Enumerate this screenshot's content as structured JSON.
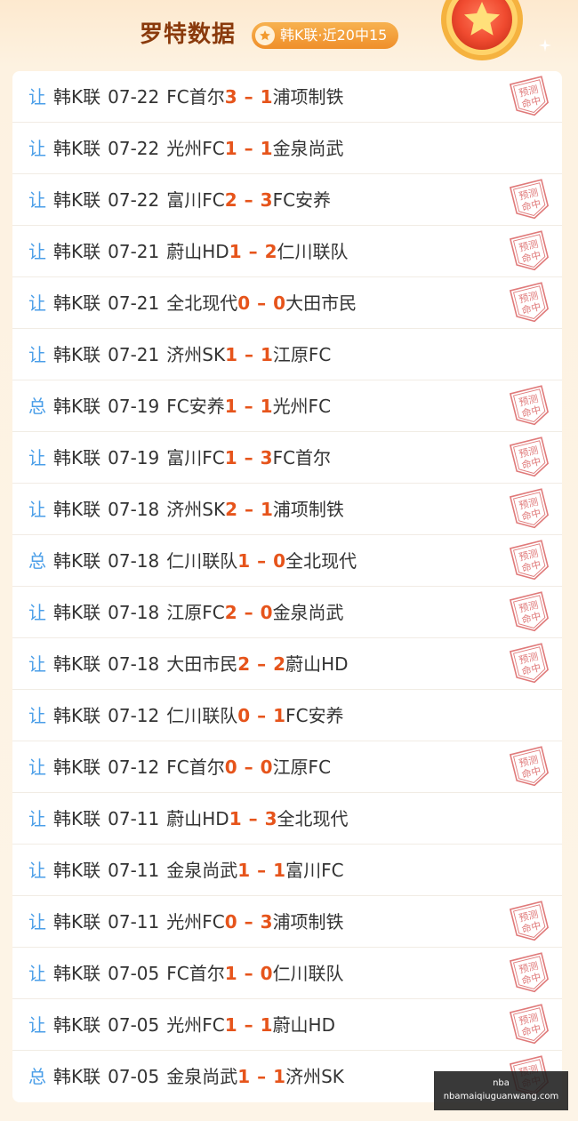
{
  "header": {
    "title": "罗特数据",
    "badge_text": "韩K联·近20中15"
  },
  "hit_stamp_text": "预测命中",
  "rows": [
    {
      "type": "让",
      "league": "韩K联",
      "date": "07-22",
      "home": "FC首尔",
      "home_score": "3",
      "away_score": "1",
      "away": "浦项制铁",
      "hit": true
    },
    {
      "type": "让",
      "league": "韩K联",
      "date": "07-22",
      "home": "光州FC",
      "home_score": "1",
      "away_score": "1",
      "away": "金泉尚武",
      "hit": false
    },
    {
      "type": "让",
      "league": "韩K联",
      "date": "07-22",
      "home": "富川FC",
      "home_score": "2",
      "away_score": "3",
      "away": "FC安养",
      "hit": true
    },
    {
      "type": "让",
      "league": "韩K联",
      "date": "07-21",
      "home": "蔚山HD",
      "home_score": "1",
      "away_score": "2",
      "away": "仁川联队",
      "hit": true
    },
    {
      "type": "让",
      "league": "韩K联",
      "date": "07-21",
      "home": "全北现代",
      "home_score": "0",
      "away_score": "0",
      "away": "大田市民",
      "hit": true
    },
    {
      "type": "让",
      "league": "韩K联",
      "date": "07-21",
      "home": "济州SK",
      "home_score": "1",
      "away_score": "1",
      "away": "江原FC",
      "hit": false
    },
    {
      "type": "总",
      "league": "韩K联",
      "date": "07-19",
      "home": "FC安养",
      "home_score": "1",
      "away_score": "1",
      "away": "光州FC",
      "hit": true
    },
    {
      "type": "让",
      "league": "韩K联",
      "date": "07-19",
      "home": "富川FC",
      "home_score": "1",
      "away_score": "3",
      "away": "FC首尔",
      "hit": true
    },
    {
      "type": "让",
      "league": "韩K联",
      "date": "07-18",
      "home": "济州SK",
      "home_score": "2",
      "away_score": "1",
      "away": "浦项制铁",
      "hit": true
    },
    {
      "type": "总",
      "league": "韩K联",
      "date": "07-18",
      "home": "仁川联队",
      "home_score": "1",
      "away_score": "0",
      "away": "全北现代",
      "hit": true
    },
    {
      "type": "让",
      "league": "韩K联",
      "date": "07-18",
      "home": "江原FC",
      "home_score": "2",
      "away_score": "0",
      "away": "金泉尚武",
      "hit": true
    },
    {
      "type": "让",
      "league": "韩K联",
      "date": "07-18",
      "home": "大田市民",
      "home_score": "2",
      "away_score": "2",
      "away": "蔚山HD",
      "hit": true
    },
    {
      "type": "让",
      "league": "韩K联",
      "date": "07-12",
      "home": "仁川联队",
      "home_score": "0",
      "away_score": "1",
      "away": "FC安养",
      "hit": false
    },
    {
      "type": "让",
      "league": "韩K联",
      "date": "07-12",
      "home": "FC首尔",
      "home_score": "0",
      "away_score": "0",
      "away": "江原FC",
      "hit": true
    },
    {
      "type": "让",
      "league": "韩K联",
      "date": "07-11",
      "home": "蔚山HD",
      "home_score": "1",
      "away_score": "3",
      "away": "全北现代",
      "hit": false
    },
    {
      "type": "让",
      "league": "韩K联",
      "date": "07-11",
      "home": "金泉尚武",
      "home_score": "1",
      "away_score": "1",
      "away": "富川FC",
      "hit": false
    },
    {
      "type": "让",
      "league": "韩K联",
      "date": "07-11",
      "home": "光州FC",
      "home_score": "0",
      "away_score": "3",
      "away": "浦项制铁",
      "hit": true
    },
    {
      "type": "让",
      "league": "韩K联",
      "date": "07-05",
      "home": "FC首尔",
      "home_score": "1",
      "away_score": "0",
      "away": "仁川联队",
      "hit": true
    },
    {
      "type": "让",
      "league": "韩K联",
      "date": "07-05",
      "home": "光州FC",
      "home_score": "1",
      "away_score": "1",
      "away": "蔚山HD",
      "hit": true
    },
    {
      "type": "总",
      "league": "韩K联",
      "date": "07-05",
      "home": "金泉尚武",
      "home_score": "1",
      "away_score": "1",
      "away": "济州SK",
      "hit": true
    }
  ],
  "watermark": {
    "line1": "nba",
    "line2": "nbamaiqiuguanwang.com"
  },
  "colors": {
    "title": "#8a3a0c",
    "badge": "#ef8f2a",
    "play_type": "#4a9ee8",
    "score": "#e6541b",
    "stamp": "#e07a7a"
  },
  "icons": {
    "badge": "star-icon",
    "medal": "medal-icon",
    "stamp": "hit-stamp-icon"
  }
}
